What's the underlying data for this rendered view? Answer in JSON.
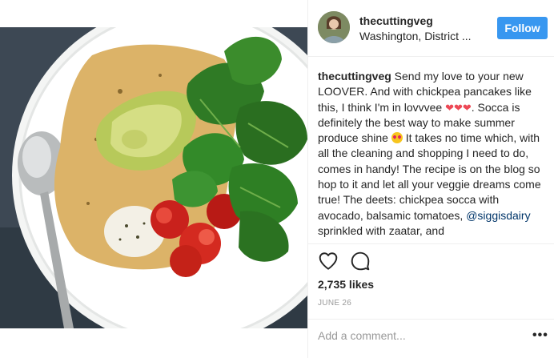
{
  "post": {
    "username": "thecuttingveg",
    "location": "Washington, District ...",
    "follow_label": "Follow",
    "caption": {
      "username": "thecuttingveg",
      "part1": " Send my love to your new LOOVER. And with chickpea pancakes like this, I think I'm in lovvvee ",
      "hearts": "❤❤❤",
      "part2": ". Socca is definitely the best way to make summer produce shine ",
      "part3": " It takes no time which, with all the cleaning and shopping I need to do, comes in handy! The recipe is on the blog so hop to it and let all your veggie dreams come true! The deets: chickpea socca with avocado, balsamic tomatoes, ",
      "mention": "@siggisdairy",
      "part4": " sprinkled with zaatar, and"
    },
    "likes": "2,735 likes",
    "date": "JUNE 26",
    "comment_placeholder": "Add a comment...",
    "more": "•••"
  },
  "icons": {
    "like": "heart-outline-icon",
    "comment": "speech-bubble-icon",
    "emoji_hearts": "red-heart-emoji",
    "emoji_face": "heart-eyes-emoji"
  },
  "colors": {
    "follow_button": "#3897f0",
    "mention": "#003569",
    "muted": "#999999",
    "heart": "#ed4956"
  }
}
